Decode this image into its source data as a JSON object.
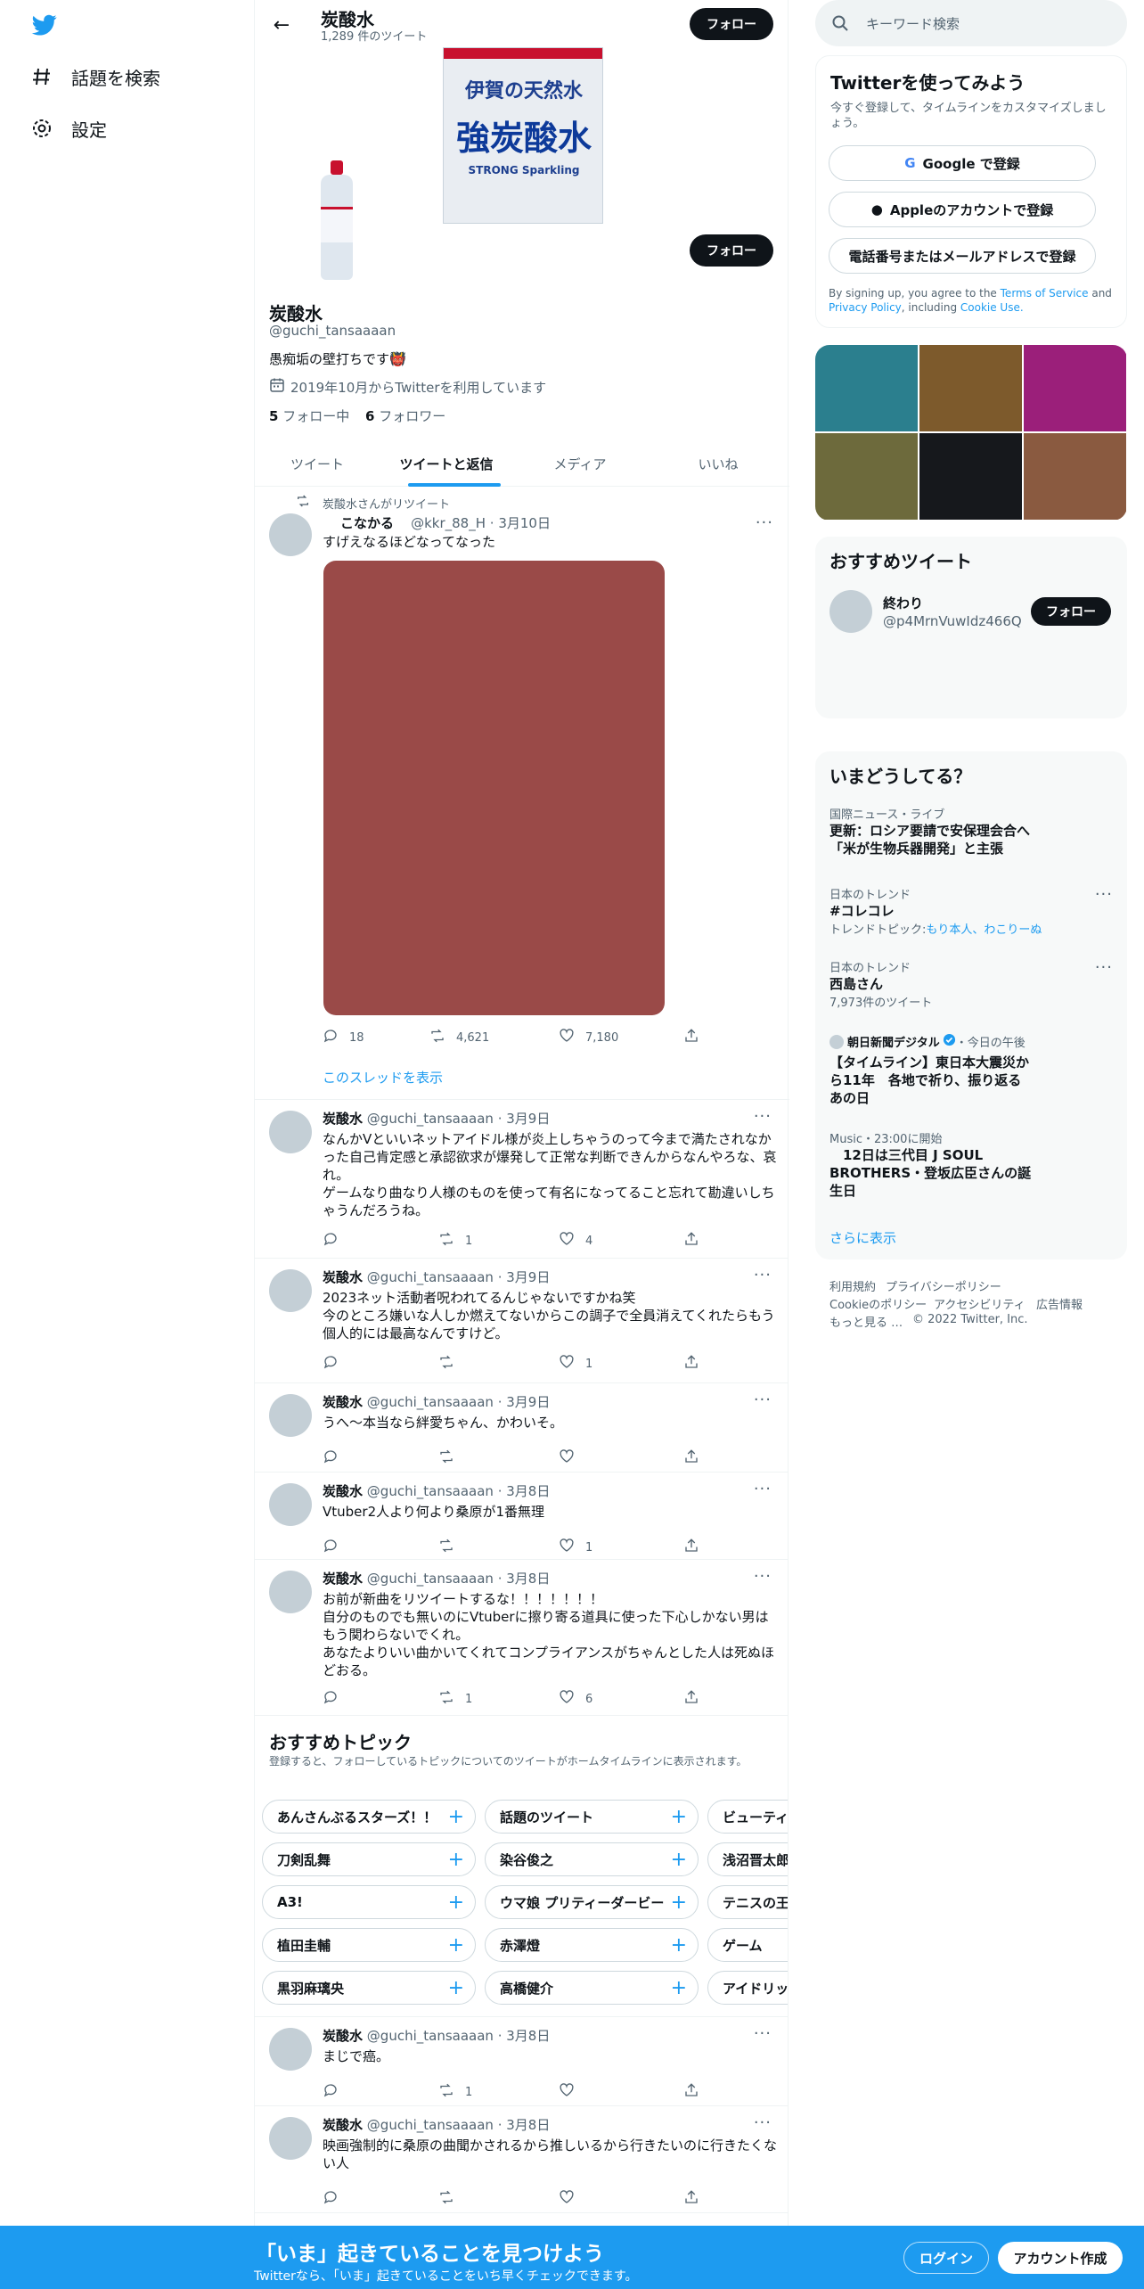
{
  "nav": {
    "explore": "話題を検索",
    "settings": "設定"
  },
  "header": {
    "name": "炭酸水",
    "tweet_count": "1,289 件のツイート",
    "follow": "フォロー"
  },
  "profile": {
    "name": "炭酸水",
    "handle": "@guchi_tansaaaan",
    "bio": "愚痴垢の壁打ちです👹",
    "joined": "2019年10月からTwitterを利用しています",
    "following_count": "5",
    "following_label": "フォロー中",
    "followers_count": "6",
    "followers_label": "フォロワー",
    "follow": "フォロー",
    "banner_label": {
      "line1": "伊賀の天然水",
      "line2": "強炭酸水",
      "line3": "STRONG Sparkling"
    }
  },
  "tabs": [
    "ツイート",
    "ツイートと返信",
    "メディア",
    "いいね"
  ],
  "retweet_note": "炭酸水さんがリツイート",
  "tweets": [
    {
      "name": "こなかる",
      "handle": "@kkr_88_H",
      "date": "3月10日",
      "text": "すげえなるほどなってなった",
      "reply": "18",
      "rt": "4,621",
      "like": "7,180",
      "thread": "このスレッドを表示"
    },
    {
      "name": "炭酸水",
      "handle": "@guchi_tansaaaan",
      "date": "3月9日",
      "text": "なんかVといいネットアイドル様が炎上しちゃうのって今まで満たされなかった自己肯定感と承認欲求が爆発して正常な判断できんからなんやろな、哀れ。\nゲームなり曲なり人様のものを使って有名になってること忘れて勘違いしちゃうんだろうね。",
      "reply": "",
      "rt": "1",
      "like": "4"
    },
    {
      "name": "炭酸水",
      "handle": "@guchi_tansaaaan",
      "date": "3月9日",
      "text": "2023ネット活動者呪われてるんじゃないですかね笑\n今のところ嫌いな人しか燃えてないからこの調子で全員消えてくれたらもう個人的には最高なんですけど。",
      "reply": "",
      "rt": "",
      "like": "1"
    },
    {
      "name": "炭酸水",
      "handle": "@guchi_tansaaaan",
      "date": "3月9日",
      "text": "うへ〜本当なら絆愛ちゃん、かわいそ。",
      "reply": "",
      "rt": "",
      "like": ""
    },
    {
      "name": "炭酸水",
      "handle": "@guchi_tansaaaan",
      "date": "3月8日",
      "text": "Vtuber2人より何より桑原が1番無理",
      "reply": "",
      "rt": "",
      "like": "1"
    },
    {
      "name": "炭酸水",
      "handle": "@guchi_tansaaaan",
      "date": "3月8日",
      "text": "お前が新曲をリツイートするな！！！！！！！\n自分のものでも無いのにVtuberに擦り寄る道具に使った下心しかない男はもう関わらないでくれ。\nあなたよりいい曲かいてくれてコンプライアンスがちゃんとした人は死ぬほどおる。",
      "reply": "",
      "rt": "1",
      "like": "6"
    },
    {
      "name": "炭酸水",
      "handle": "@guchi_tansaaaan",
      "date": "3月8日",
      "text": "まじで癌。",
      "reply": "",
      "rt": "1",
      "like": ""
    },
    {
      "name": "炭酸水",
      "handle": "@guchi_tansaaaan",
      "date": "3月8日",
      "text": "映画強制的に桑原の曲聞かされるから推しいるから行きたいのに行きたくない人",
      "reply": "",
      "rt": "",
      "like": ""
    }
  ],
  "topics": {
    "title": "おすすめトピック",
    "subtitle": "登録すると、フォローしているトピックについてのツイートがホームタイムラインに表示されます。",
    "rows": [
      [
        "あんさんぶるスターズ！！",
        "話題のツイート",
        "ビューティー"
      ],
      [
        "刀剣乱舞",
        "染谷俊之",
        "浅沼晋太郎"
      ],
      [
        "A3!",
        "ウマ娘 プリティーダービー",
        "テニスの王子様"
      ],
      [
        "植田圭輔",
        "赤澤燈",
        "ゲーム"
      ],
      [
        "黒羽麻璃央",
        "高橋健介",
        "アイドリッシュセブン"
      ]
    ]
  },
  "right": {
    "search_placeholder": "キーワード検索",
    "signup_title": "Twitterを使ってみよう",
    "signup_sub": "今すぐ登録して、タイムラインをカスタマイズしましょう。",
    "google": "Google で登録",
    "apple": "Appleのアカウントで登録",
    "phone": "電話番号またはメールアドレスで登録",
    "terms_pre": "By signing up, you agree to the ",
    "terms": "Terms of Service",
    "terms_and": " and ",
    "privacy": "Privacy Policy",
    "including": ", including ",
    "cookie": "Cookie Use.",
    "media_colors": [
      "#2b7f8e",
      "#7d5a2c",
      "#9b1f7a",
      "#6d6a3c",
      "#16181c",
      "#8a5a40"
    ],
    "rec_title": "おすすめツイート",
    "rec_name": "終わり",
    "rec_handle": "@p4MrnVuwIdz466Q",
    "rec_follow": "フォロー",
    "trends_title": "いまどうしてる？",
    "trends": [
      {
        "cat": "国際ニュース・ライブ",
        "title": "更新：ロシア要請で安保理会合へ\n「米が生物兵器開発」と主張",
        "sub": ""
      },
      {
        "cat": "日本のトレンド",
        "title": "#コレコレ",
        "sub": "トレンドトピック:",
        "links": "もり本人、わこりーぬ"
      },
      {
        "cat": "日本のトレンド",
        "title": "西島さん",
        "sub": "7,973件のツイート"
      },
      {
        "cat": "朝日新聞デジタル",
        "cat2": "・今日の午後",
        "title": "【タイムライン】東日本大震災から11年　各地で祈り、振り返るあの日",
        "sub": ""
      },
      {
        "cat": "Music・23:00に開始",
        "title": "　12日は三代目 J SOUL BROTHERS・登坂広臣さんの誕生日",
        "sub": ""
      }
    ],
    "show_more": "さらに表示",
    "footer": [
      "利用規約",
      "プライバシーポリシー",
      "Cookieのポリシー",
      "アクセシビリティ",
      "広告情報",
      "もっと見る …",
      "© 2022 Twitter, Inc."
    ]
  },
  "banner": {
    "title": "「いま」起きていることを見つけよう",
    "sub": "Twitterなら、「いま」起きていることをいち早くチェックできます。",
    "login": "ログイン",
    "signup": "アカウント作成"
  },
  "colors": {
    "accent": "#1d9bf0",
    "dark": "#0f1419",
    "tweet_image": "#9a4a48"
  }
}
